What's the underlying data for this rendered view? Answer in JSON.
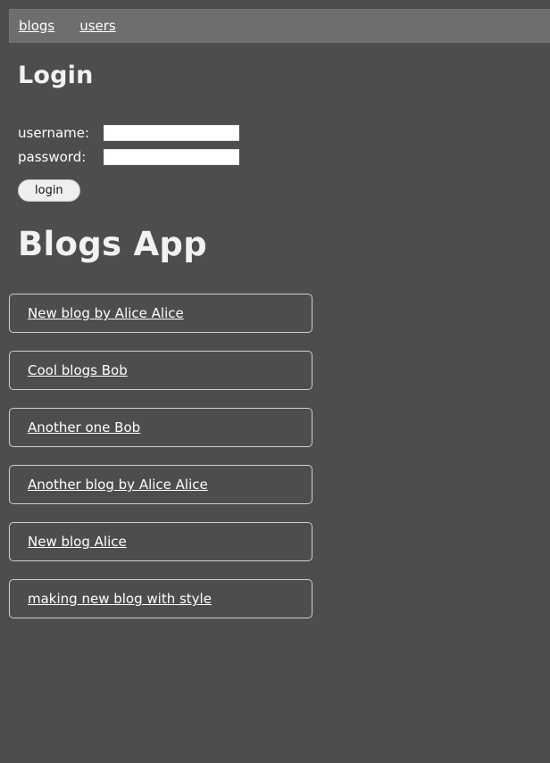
{
  "navbar": {
    "links": [
      {
        "label": "blogs"
      },
      {
        "label": "users"
      }
    ]
  },
  "login": {
    "heading": "Login",
    "username_label": "username:",
    "username_value": "",
    "password_label": "password:",
    "password_value": "",
    "submit_label": "login"
  },
  "blogs": {
    "heading": "Blogs App",
    "items": [
      {
        "title": "New blog by Alice Alice"
      },
      {
        "title": "Cool blogs Bob"
      },
      {
        "title": "Another one Bob"
      },
      {
        "title": "Another blog by Alice Alice"
      },
      {
        "title": "New blog Alice"
      },
      {
        "title": "making new blog with style"
      }
    ]
  }
}
